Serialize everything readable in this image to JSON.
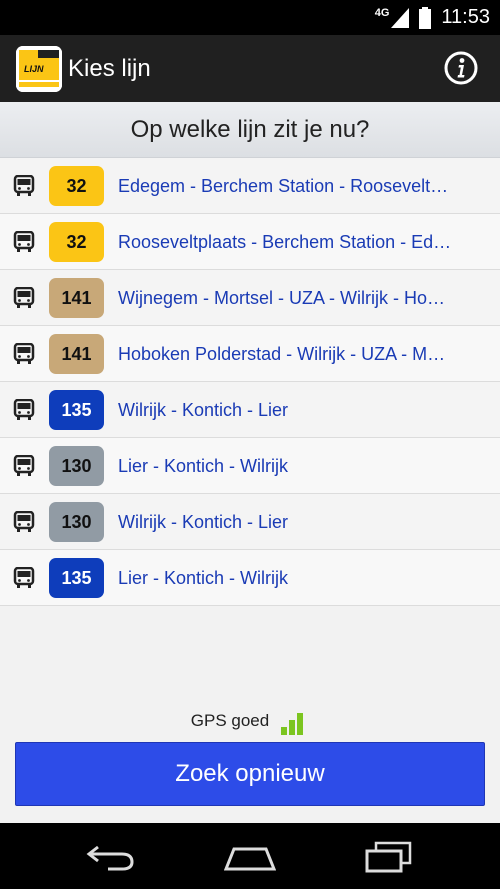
{
  "status_bar": {
    "network": "4G",
    "time": "11:53"
  },
  "app_bar": {
    "logo_text": "LIJN",
    "title": "Kies lijn",
    "info_icon": "info-icon"
  },
  "heading": "Op welke lijn zit je nu?",
  "lines": [
    {
      "number": "32",
      "color": "#fbc515",
      "text_color": "#111111",
      "route": "Edegem - Berchem Station - Roosevelt…"
    },
    {
      "number": "32",
      "color": "#fbc515",
      "text_color": "#111111",
      "route": "Rooseveltplaats - Berchem Station - Ed…"
    },
    {
      "number": "141",
      "color": "#c8a878",
      "text_color": "#111111",
      "route": "Wijnegem - Mortsel - UZA - Wilrijk -  Ho…"
    },
    {
      "number": "141",
      "color": "#c8a878",
      "text_color": "#111111",
      "route": "Hoboken Polderstad - Wilrijk -  UZA - M…"
    },
    {
      "number": "135",
      "color": "#0e3dbb",
      "text_color": "#ffffff",
      "route": "Wilrijk - Kontich - Lier"
    },
    {
      "number": "130",
      "color": "#919ba4",
      "text_color": "#111111",
      "route": "Lier - Kontich - Wilrijk"
    },
    {
      "number": "130",
      "color": "#919ba4",
      "text_color": "#111111",
      "route": "Wilrijk - Kontich - Lier"
    },
    {
      "number": "135",
      "color": "#0e3dbb",
      "text_color": "#ffffff",
      "route": "Lier - Kontich - Wilrijk"
    }
  ],
  "gps": {
    "label": "GPS goed",
    "icon": "signal-bars-icon",
    "color": "#7cc520"
  },
  "search_button": {
    "label": "Zoek opnieuw",
    "color": "#2d4ce8"
  },
  "nav": {
    "back_icon": "back-icon",
    "home_icon": "home-icon",
    "recents_icon": "recents-icon"
  }
}
